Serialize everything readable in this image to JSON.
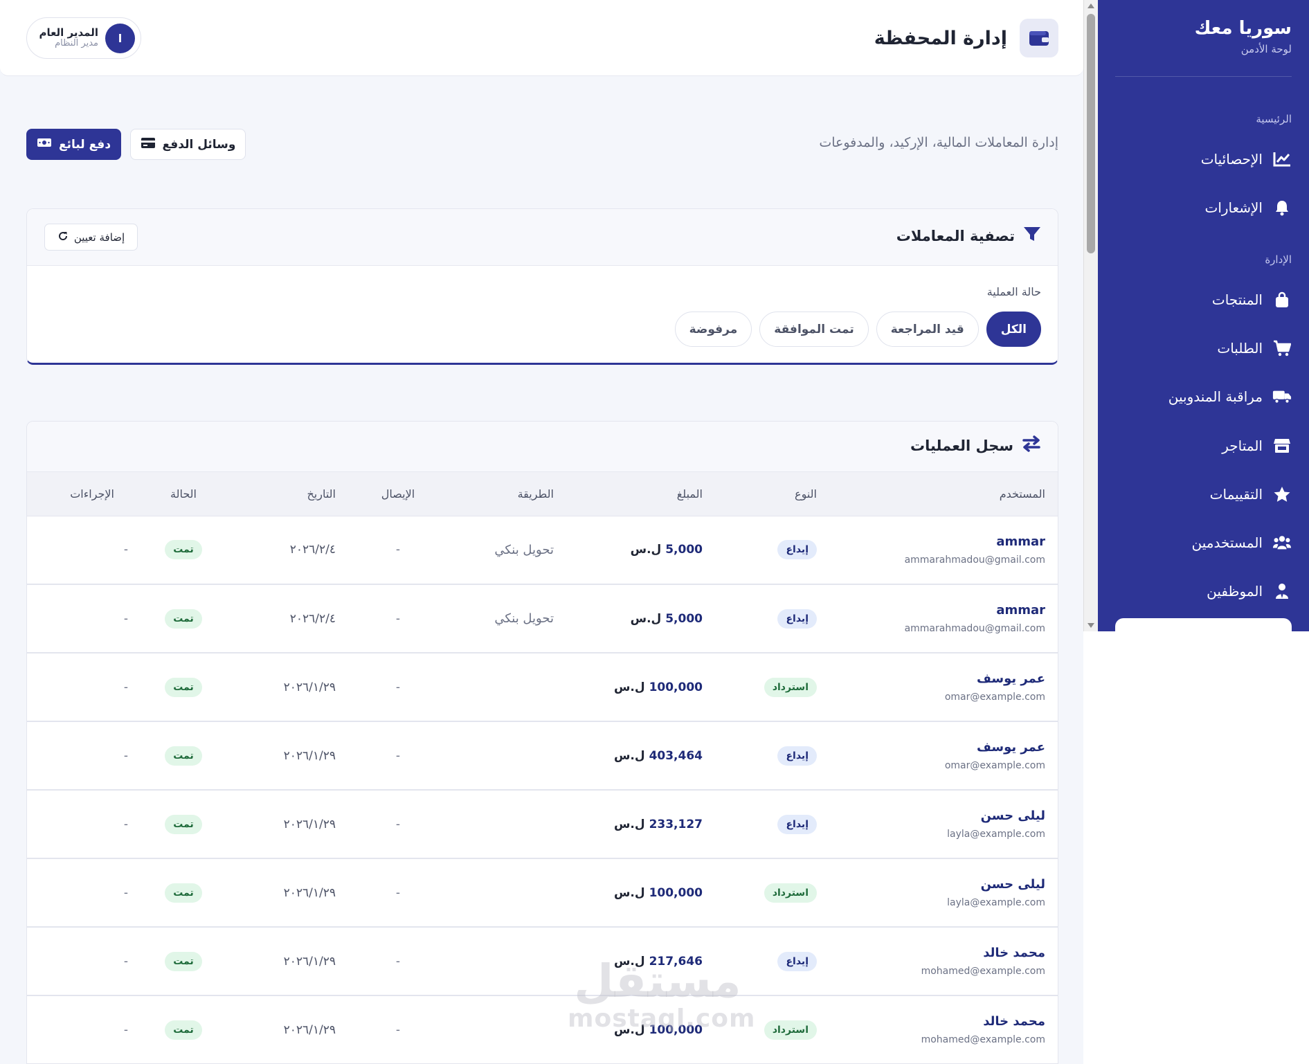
{
  "sidebar": {
    "brand": "سوريا معك",
    "brand_sub": "لوحة الأدمن",
    "section_main": "الرئيسية",
    "section_admin": "الإدارة",
    "items": [
      {
        "label": "الإحصائيات",
        "icon": "chart-line-icon"
      },
      {
        "label": "الإشعارات",
        "icon": "bell-icon"
      },
      {
        "label": "المنتجات",
        "icon": "shopping-bag-icon"
      },
      {
        "label": "الطلبات",
        "icon": "cart-icon"
      },
      {
        "label": "مراقبة المندوبين",
        "icon": "truck-icon"
      },
      {
        "label": "المتاجر",
        "icon": "store-icon"
      },
      {
        "label": "التقييمات",
        "icon": "star-icon"
      },
      {
        "label": "المستخدمين",
        "icon": "users-icon"
      },
      {
        "label": "الموظفين",
        "icon": "user-tie-icon"
      }
    ]
  },
  "header": {
    "title": "إدارة المحفظة",
    "user_name": "المدير العام",
    "user_role": "مدير النظام",
    "avatar_letter": "ا"
  },
  "toolbar": {
    "subtitle": "إدارة المعاملات المالية، الإركيد، والمدفوعات",
    "pay_vendor": "دفع لبائع",
    "payment_methods": "وسائل الدفع"
  },
  "filter": {
    "title": "تصفية المعاملات",
    "reset": "إضافة تعيين",
    "status_label": "حالة العملية",
    "chips": [
      "الكل",
      "قيد المراجعة",
      "تمت الموافقة",
      "مرفوضة"
    ],
    "active_chip": 0
  },
  "table": {
    "title": "سجل العمليات",
    "headers": {
      "user": "المستخدم",
      "type": "النوع",
      "amount": "المبلغ",
      "method": "الطريقة",
      "receipt": "الإيصال",
      "date": "التاريخ",
      "status": "الحالة",
      "actions": "الإجراءات"
    },
    "currency": "ل.س",
    "rows": [
      {
        "name": "ammar",
        "email": "ammarahmadou@gmail.com",
        "type": "إيداع",
        "type_kind": "deposit",
        "amount": "5,000",
        "method": "تحويل بنكي",
        "receipt": "-",
        "date": "٢٠٢٦/٢/٤",
        "status": "تمت",
        "actions": "-"
      },
      {
        "name": "ammar",
        "email": "ammarahmadou@gmail.com",
        "type": "إيداع",
        "type_kind": "deposit",
        "amount": "5,000",
        "method": "تحويل بنكي",
        "receipt": "-",
        "date": "٢٠٢٦/٢/٤",
        "status": "تمت",
        "actions": "-"
      },
      {
        "name": "عمر يوسف",
        "email": "omar@example.com",
        "type": "استرداد",
        "type_kind": "refund",
        "amount": "100,000",
        "method": "",
        "receipt": "-",
        "date": "٢٠٢٦/١/٢٩",
        "status": "تمت",
        "actions": "-"
      },
      {
        "name": "عمر يوسف",
        "email": "omar@example.com",
        "type": "إيداع",
        "type_kind": "deposit",
        "amount": "403,464",
        "method": "",
        "receipt": "-",
        "date": "٢٠٢٦/١/٢٩",
        "status": "تمت",
        "actions": "-"
      },
      {
        "name": "ليلى حسن",
        "email": "layla@example.com",
        "type": "إيداع",
        "type_kind": "deposit",
        "amount": "233,127",
        "method": "",
        "receipt": "-",
        "date": "٢٠٢٦/١/٢٩",
        "status": "تمت",
        "actions": "-"
      },
      {
        "name": "ليلى حسن",
        "email": "layla@example.com",
        "type": "استرداد",
        "type_kind": "refund",
        "amount": "100,000",
        "method": "",
        "receipt": "-",
        "date": "٢٠٢٦/١/٢٩",
        "status": "تمت",
        "actions": "-"
      },
      {
        "name": "محمد خالد",
        "email": "mohamed@example.com",
        "type": "إيداع",
        "type_kind": "deposit",
        "amount": "217,646",
        "method": "",
        "receipt": "-",
        "date": "٢٠٢٦/١/٢٩",
        "status": "تمت",
        "actions": "-"
      },
      {
        "name": "محمد خالد",
        "email": "mohamed@example.com",
        "type": "استرداد",
        "type_kind": "refund",
        "amount": "100,000",
        "method": "",
        "receipt": "-",
        "date": "٢٠٢٦/١/٢٩",
        "status": "تمت",
        "actions": "-"
      }
    ]
  },
  "watermark": {
    "arabic": "مستقل",
    "latin": "mostaql.com"
  },
  "colors": {
    "primary": "#2e3596",
    "deposit_bg": "#e3ebfb",
    "success_bg": "#e1f6e8",
    "success_text": "#1f6b3b"
  }
}
